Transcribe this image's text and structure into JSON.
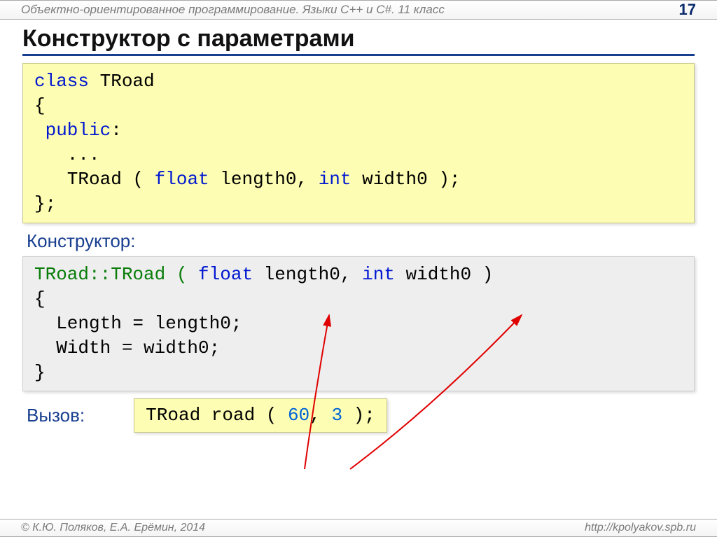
{
  "header": {
    "course": "Объектно-ориентированное программирование. Языки C++ и C#. 11 класс",
    "page": "17"
  },
  "title": "Конструктор с параметрами",
  "code1": {
    "l1a": "class",
    "l1b": " TRoad",
    "l2": "{",
    "l3a": " public",
    "l3b": ":",
    "l4": "   ...",
    "l5a": "   TRoad ( ",
    "l5b": "float",
    "l5c": " length0, ",
    "l5d": "int",
    "l5e": " width0 );",
    "l6": "};"
  },
  "labels": {
    "constructor": "Конструктор:",
    "call": "Вызов:"
  },
  "code2": {
    "l1a": "TRoad::TRoad ( ",
    "l1b": "float",
    "l1c": " length0, ",
    "l1d": "int",
    "l1e": " width0 )",
    "l2": "{",
    "l3": "  Length = length0;",
    "l4": "  Width = width0;",
    "l5": "}"
  },
  "code3": {
    "a": "TRoad road ( ",
    "n1": "60",
    "b": ", ",
    "n2": "3",
    "c": " );"
  },
  "footer": {
    "left": "© К.Ю. Поляков, Е.А. Ерёмин, 2014",
    "right": "http://kpolyakov.spb.ru"
  }
}
